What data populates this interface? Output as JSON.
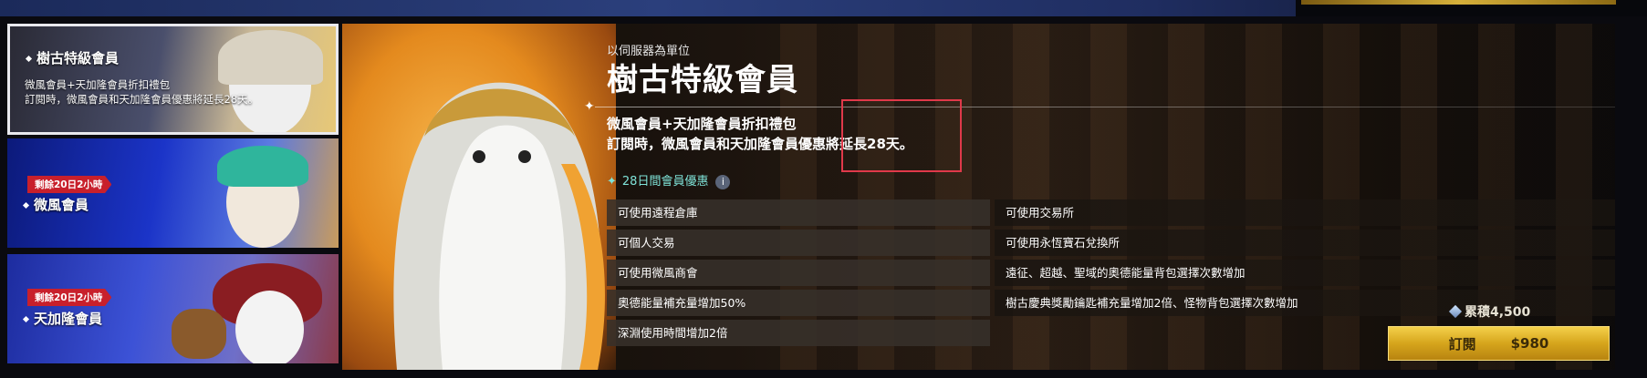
{
  "cards": [
    {
      "title": "樹古特級會員",
      "sub1": "微風會員+天加隆會員折扣禮包",
      "sub2": "訂閱時，微風會員和天加隆會員優惠將延長28天。",
      "selected": true
    },
    {
      "badge": "剩餘20日2小時",
      "title": "微風會員"
    },
    {
      "badge": "剩餘20日2小時",
      "title": "天加隆會員"
    }
  ],
  "detail": {
    "server_note": "以伺服器為單位",
    "title": "樹古特級會員",
    "desc1": "微風會員+天加隆會員折扣禮包",
    "desc2": "訂閱時，微風會員和天加隆會員優惠將延長28天。",
    "benefit_header": "28日間會員優惠",
    "info_icon": "i",
    "benefits_left": [
      "可使用遠程倉庫",
      "可個人交易",
      "可使用微風商會",
      "奧德能量補充量增加50%",
      "深淵使用時間增加2倍"
    ],
    "benefits_right": [
      "可使用交易所",
      "可使用永恆寶石兌換所",
      "遠征、超越、聖域的奧德能量背包選擇次數增加",
      "樹古慶典獎勵鑰匙補充量增加2倍、怪物背包選擇次數增加"
    ]
  },
  "purchase": {
    "points": "累積4,500",
    "label": "訂閱",
    "price": "$980"
  },
  "colors": {
    "accent_gold": "#d6a51c",
    "badge_red": "#c8202c",
    "highlight_box": "#e0394a",
    "benefit_teal": "#7fe3d8"
  },
  "icons": [
    "sparkle-icon",
    "info-icon",
    "gem-icon"
  ]
}
